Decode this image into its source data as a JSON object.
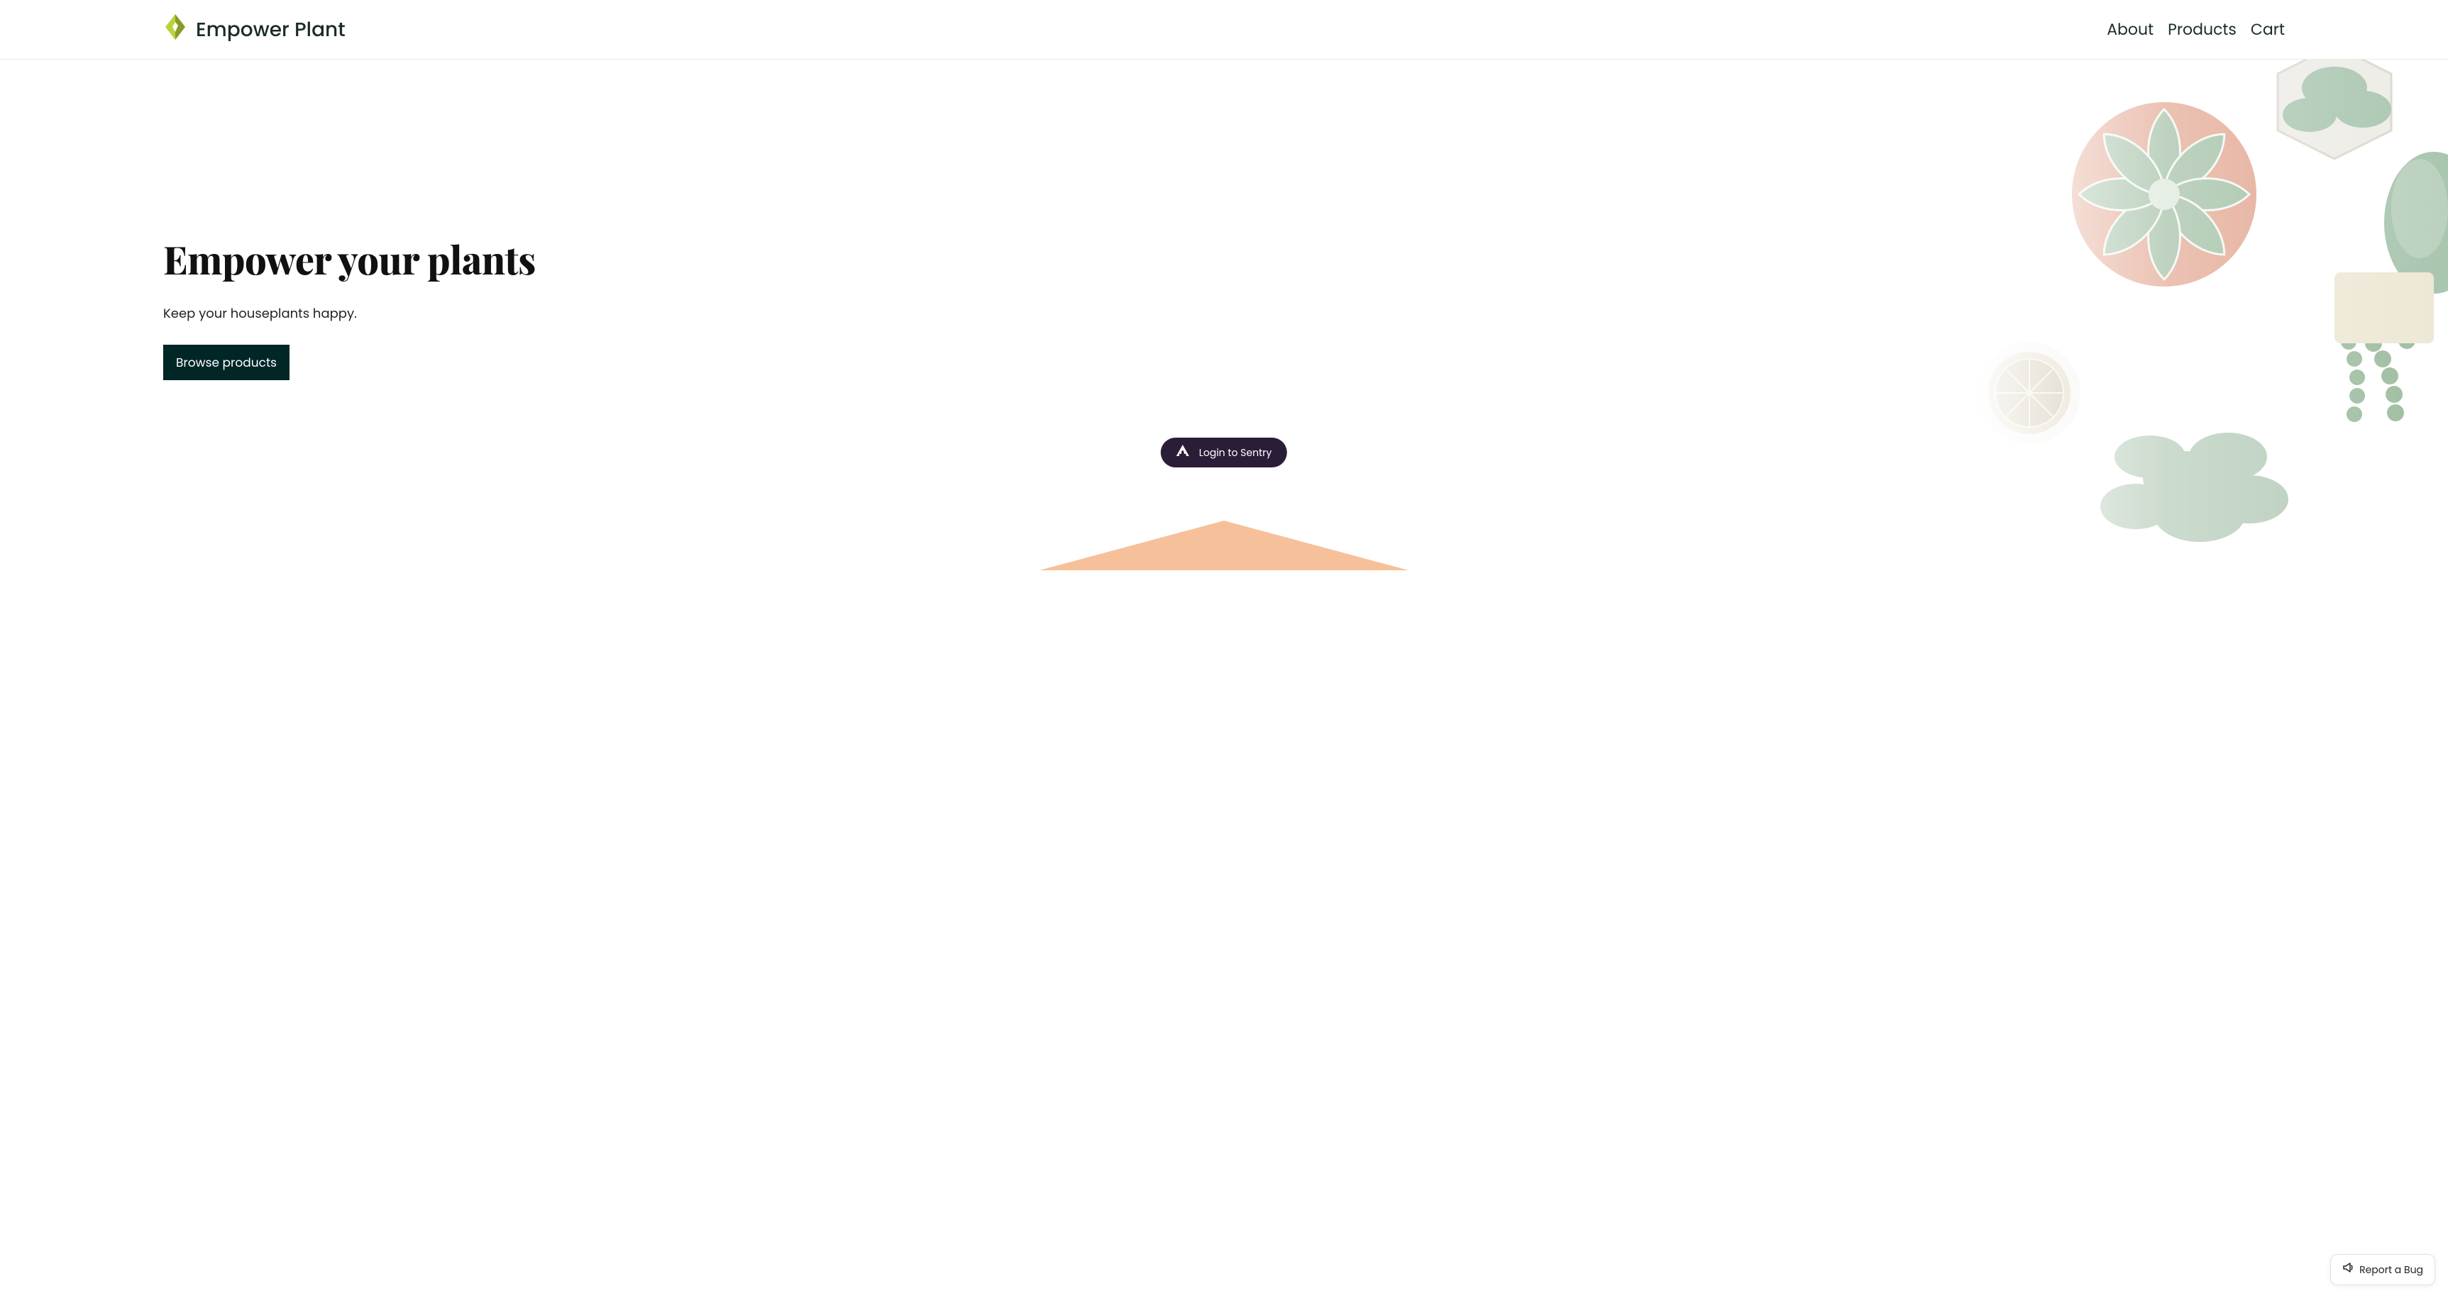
{
  "header": {
    "brand_name": "Empower Plant",
    "nav": [
      {
        "label": "About"
      },
      {
        "label": "Products"
      },
      {
        "label": "Cart"
      }
    ]
  },
  "hero": {
    "title": "Empower your plants",
    "subtitle": "Keep your houseplants happy.",
    "browse_label": "Browse products"
  },
  "sentry": {
    "login_label": "Login to Sentry"
  },
  "report_bug": {
    "label": "Report a Bug"
  },
  "colors": {
    "brand_dark": "#002626",
    "logo_green": "#b9d33c",
    "logo_olive": "#8a9a2a",
    "peach": "#f6c19a",
    "sentry_bg": "#2b1d38"
  }
}
